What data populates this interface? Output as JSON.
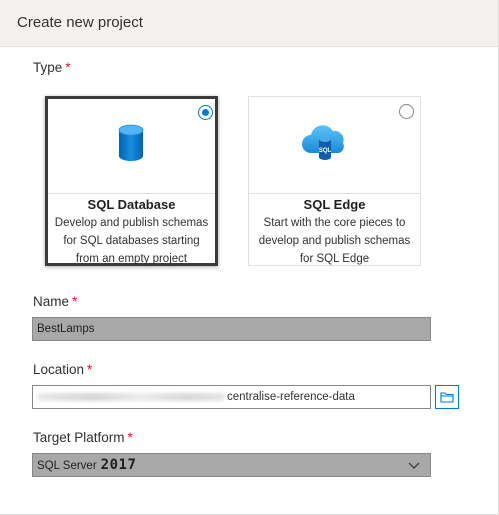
{
  "header": {
    "title": "Create new project"
  },
  "type_section": {
    "label": "Type",
    "required_mark": "*",
    "cards": [
      {
        "title": "SQL Database",
        "description": "Develop and publish schemas for SQL databases starting from an empty project",
        "icon": "database-cylinder-icon",
        "selected": true
      },
      {
        "title": "SQL Edge",
        "description": "Start with the core pieces to develop and publish schemas for SQL Edge",
        "icon": "sql-edge-cloud-icon",
        "icon_badge": "SQL",
        "selected": false
      }
    ]
  },
  "name_field": {
    "label": "Name",
    "required_mark": "*",
    "value": "BestLamps"
  },
  "location_field": {
    "label": "Location",
    "required_mark": "*",
    "value": "centralise-reference-data",
    "browse_icon": "folder-icon"
  },
  "target_platform": {
    "label": "Target Platform",
    "required_mark": "*",
    "selected_prefix": "SQL Server",
    "selected_version": "2017",
    "dropdown_icon": "chevron-down-icon"
  },
  "colors": {
    "accent": "#0078d4",
    "required": "#e81123",
    "header_bg": "#f3f2f1",
    "readonly_bg": "#a8a8a8"
  }
}
